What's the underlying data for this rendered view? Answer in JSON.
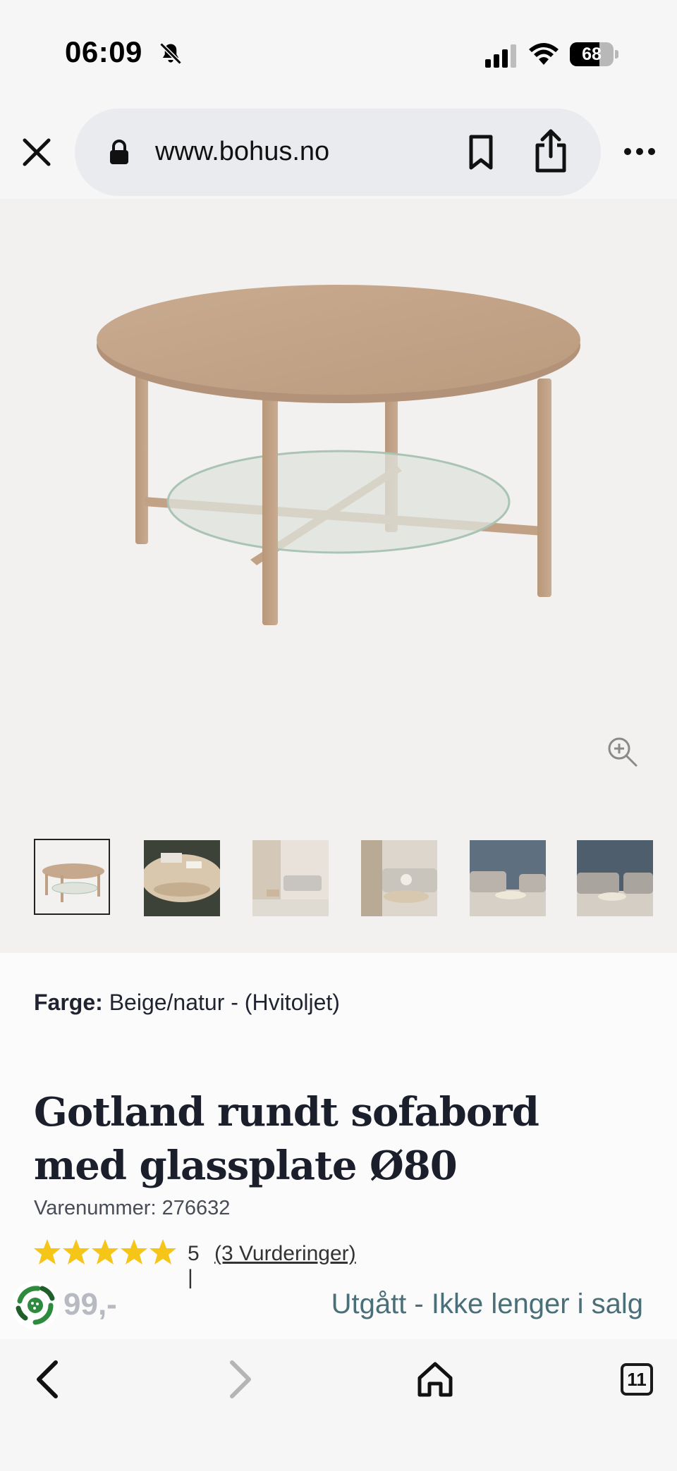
{
  "status_bar": {
    "time": "06:09",
    "battery": 68,
    "battery_label": "68"
  },
  "browser": {
    "url": "www.bohus.no"
  },
  "product": {
    "color_label": "Farge:",
    "color_value": "Beige/natur - (Hvitoljet)",
    "title": "Gotland rundt sofabord med glassplate Ø80",
    "sku": "Varenummer: 276632",
    "rating_value": 5,
    "rating_score": "5 |",
    "rating_count": "(3 Vurderinger)",
    "price_partial": "99,-",
    "sale_status": "Utgått - Ikke lenger i salg"
  },
  "gallery": {
    "thumbnail_count": 6,
    "active_index": 0
  },
  "bottom_nav": {
    "tabs_count": "11"
  },
  "colors": {
    "star": "#f5c518",
    "hero_bg": "#f3f1ef",
    "status_text": "#4a6f78",
    "eco_badge": "#2e8b3e"
  }
}
